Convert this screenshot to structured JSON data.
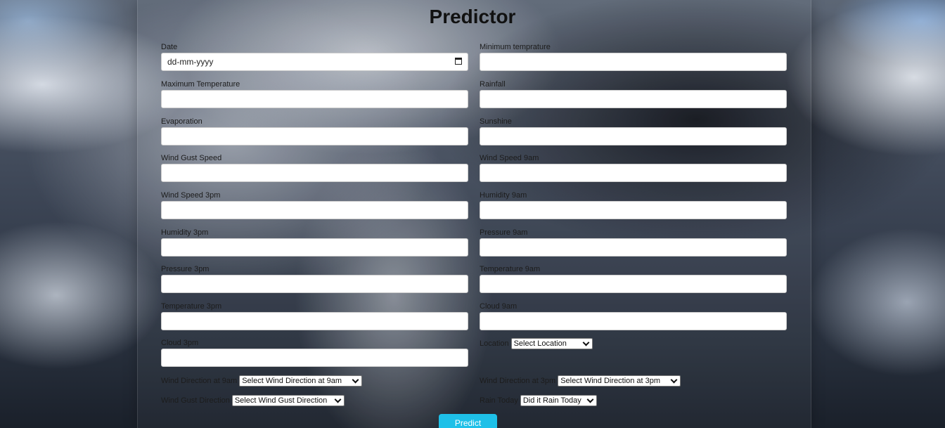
{
  "title": "Predictor",
  "left_fields": [
    {
      "label": "Date",
      "placeholder": "dd-mm-yyyy"
    },
    {
      "label": "Maximum Temperature"
    },
    {
      "label": "Evaporation"
    },
    {
      "label": "Wind Gust Speed"
    },
    {
      "label": "Wind Speed 3pm"
    },
    {
      "label": "Humidity 3pm"
    },
    {
      "label": "Pressure 3pm"
    },
    {
      "label": "Temperature 3pm"
    },
    {
      "label": "Cloud 3pm"
    }
  ],
  "right_fields": [
    {
      "label": "Minimum temprature"
    },
    {
      "label": "Rainfall"
    },
    {
      "label": "Sunshine"
    },
    {
      "label": "Wind Speed 9am"
    },
    {
      "label": "Humidity 9am"
    },
    {
      "label": "Pressure 9am"
    },
    {
      "label": "Temperature 9am"
    },
    {
      "label": "Cloud 9am"
    }
  ],
  "location": {
    "label": "Location",
    "selected": "Select Location"
  },
  "wind_dir_9am": {
    "label": "Wind Direction at 9am",
    "selected": "Select Wind Direction at 9am"
  },
  "wind_dir_3pm": {
    "label": "Wind Direction at 3pm",
    "selected": "Select Wind Direction at 3pm"
  },
  "wind_gust_dir": {
    "label": "Wind Gust Direction",
    "selected": "Select Wind Gust Direction"
  },
  "rain_today": {
    "label": "Rain Today",
    "selected": "Did it Rain Today"
  },
  "predict_label": "Predict"
}
